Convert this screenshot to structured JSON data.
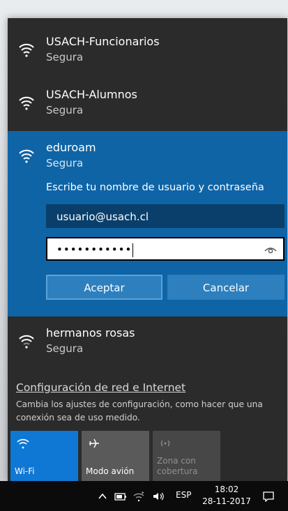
{
  "networks": [
    {
      "ssid": "USACH-Funcionarios",
      "security": "Segura",
      "icon": "wifi-icon"
    },
    {
      "ssid": "USACH-Alumnos",
      "security": "Segura",
      "icon": "wifi-icon"
    },
    {
      "ssid": "eduroam",
      "security": "Segura",
      "icon": "wifi-icon"
    },
    {
      "ssid": "hermanos rosas",
      "security": "Segura",
      "icon": "wifi-icon"
    }
  ],
  "login": {
    "prompt": "Escribe tu nombre de usuario y contraseña",
    "username_value": "usuario@usach.cl",
    "password_masked": "•••••••••••",
    "ok_label": "Aceptar",
    "cancel_label": "Cancelar"
  },
  "settings": {
    "link": "Configuración de red e Internet",
    "description": "Cambia los ajustes de configuración, como hacer que una conexión sea de uso medido."
  },
  "quick_actions": [
    {
      "label": "Wi-Fi",
      "icon": "wifi-icon",
      "state": "on"
    },
    {
      "label": "Modo avión",
      "icon": "airplane-icon",
      "state": "off"
    },
    {
      "label": "Zona con cobertura",
      "icon": "hotspot-icon",
      "state": "disabled"
    }
  ],
  "taskbar": {
    "language": "ESP",
    "time": "18:02",
    "date": "28-11-2017"
  },
  "colors": {
    "accent": "#0f64a6",
    "tile_on": "#0f78d4"
  }
}
